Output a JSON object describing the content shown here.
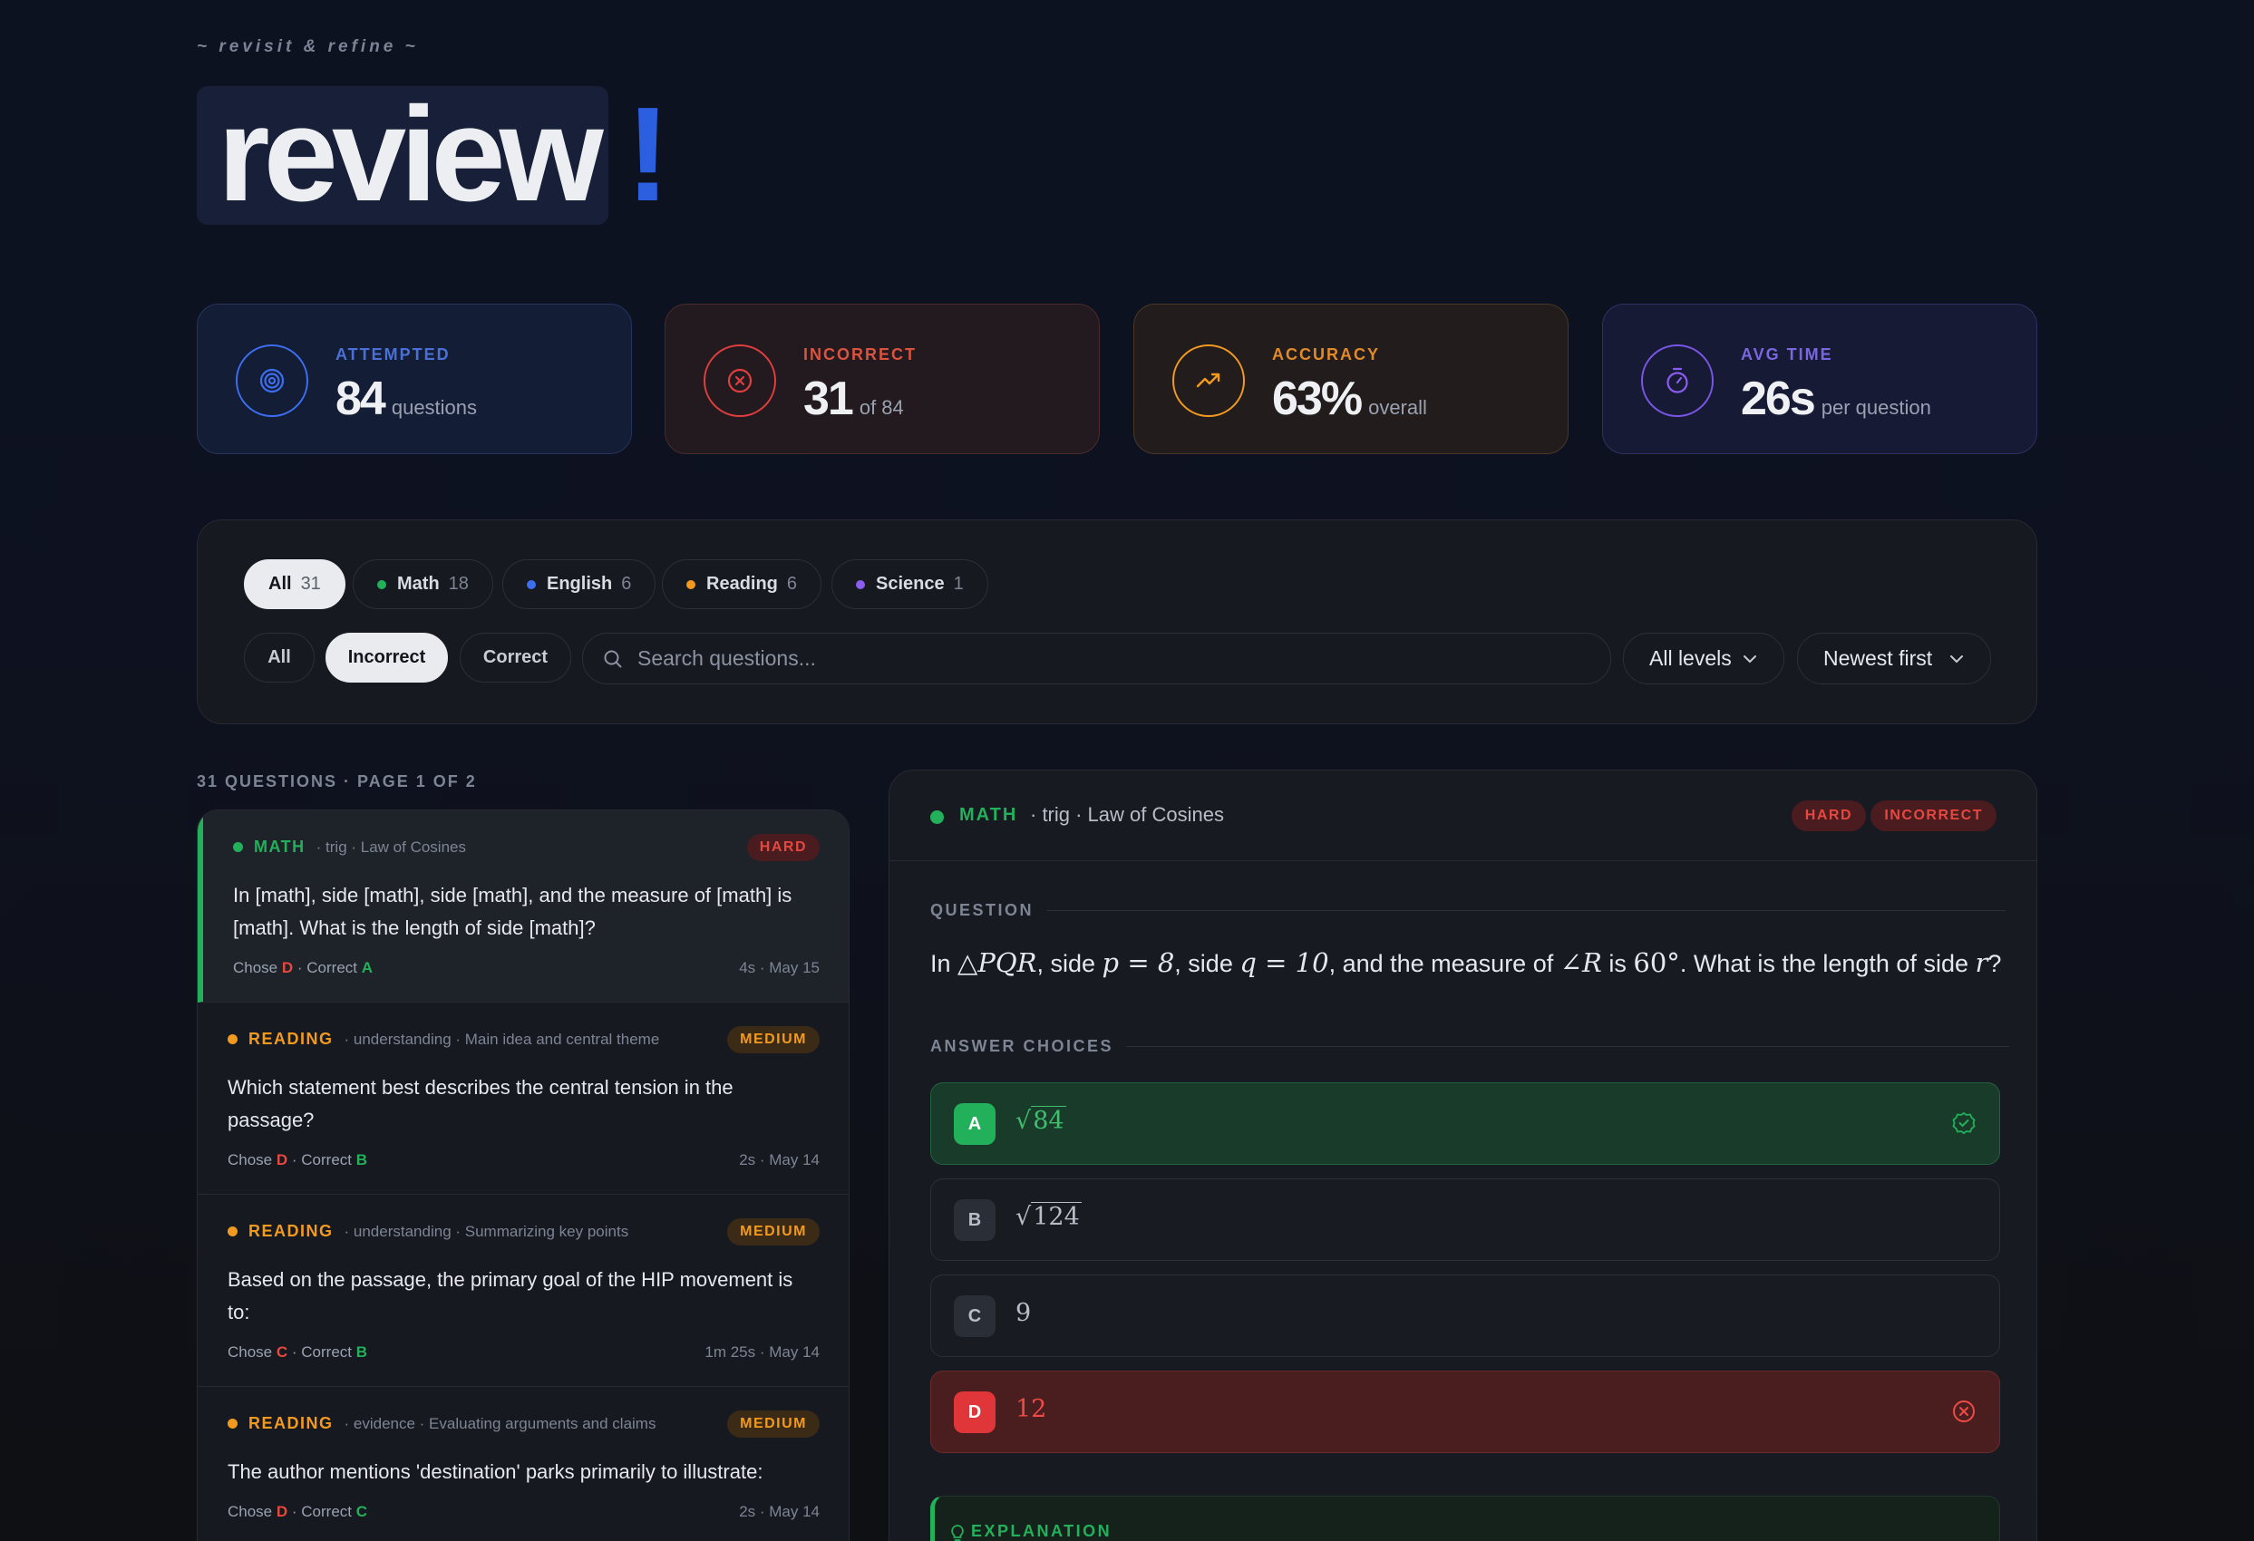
{
  "header": {
    "tagline": "~ revisit & refine ~",
    "title": "review",
    "bang": "!"
  },
  "stats": [
    {
      "label": "ATTEMPTED",
      "value": "84",
      "sub": "questions",
      "icon": "target-icon",
      "color": "#3d6ef0"
    },
    {
      "label": "INCORRECT",
      "value": "31",
      "sub": "of 84",
      "icon": "x-circle-icon",
      "color": "#e03e3e"
    },
    {
      "label": "ACCURACY",
      "value": "63%",
      "sub": "overall",
      "icon": "trending-up-icon",
      "color": "#f29a1f"
    },
    {
      "label": "AVG TIME",
      "value": "26s",
      "sub": "per question",
      "icon": "stopwatch-icon",
      "color": "#7a56e6"
    }
  ],
  "subjects": [
    {
      "label": "All",
      "count": "31",
      "active": true
    },
    {
      "label": "Math",
      "count": "18",
      "color": "#22b15a"
    },
    {
      "label": "English",
      "count": "6",
      "color": "#3d6ef0"
    },
    {
      "label": "Reading",
      "count": "6",
      "color": "#f29a1f"
    },
    {
      "label": "Science",
      "count": "1",
      "color": "#8a5cf0"
    }
  ],
  "result_filters": [
    {
      "label": "All"
    },
    {
      "label": "Incorrect",
      "active": true
    },
    {
      "label": "Correct"
    }
  ],
  "search": {
    "placeholder": "Search questions..."
  },
  "level_select": {
    "value": "All levels"
  },
  "sort_select": {
    "value": "Newest first"
  },
  "list_heading": "31 QUESTIONS · PAGE 1 OF 2",
  "questions": [
    {
      "subject": "MATH",
      "color": "#22b15a",
      "topic": "· trig · Law of Cosines",
      "difficulty": "HARD",
      "text": "In [math], side [math], side [math], and the measure of [math] is [math]. What is the length of side [math]?",
      "chose_label": "Chose",
      "chose": "D",
      "correct_label": "· Correct",
      "correct": "A",
      "time": "4s · May 15"
    },
    {
      "subject": "READING",
      "color": "#f29a1f",
      "topic": "· understanding · Main idea and central theme",
      "difficulty": "MEDIUM",
      "text": "Which statement best describes the central tension in the passage?",
      "chose_label": "Chose",
      "chose": "D",
      "correct_label": "· Correct",
      "correct": "B",
      "time": "2s · May 14"
    },
    {
      "subject": "READING",
      "color": "#f29a1f",
      "topic": "· understanding · Summarizing key points",
      "difficulty": "MEDIUM",
      "text": "Based on the passage, the primary goal of the HIP movement is to:",
      "chose_label": "Chose",
      "chose": "C",
      "correct_label": "· Correct",
      "correct": "B",
      "time": "1m 25s · May 14"
    },
    {
      "subject": "READING",
      "color": "#f29a1f",
      "topic": "· evidence · Evaluating arguments and claims",
      "difficulty": "MEDIUM",
      "text": "The author mentions 'destination' parks primarily to illustrate:",
      "chose_label": "Chose",
      "chose": "D",
      "correct_label": "· Correct",
      "correct": "C",
      "time": "2s · May 14"
    }
  ],
  "detail": {
    "subject": "MATH",
    "topic": "· trig · Law of Cosines",
    "badges": [
      "HARD",
      "INCORRECT"
    ],
    "question_heading": "QUESTION",
    "q": {
      "p1": "In",
      "tri": "△PQR",
      "p2": ", side",
      "pv": "p = 8",
      "p3": ", side",
      "qv": "q = 10",
      "p4": ", and the measure of",
      "ang": "∠R",
      "p5": "is",
      "deg": "60°",
      "p6": ". What is the length of side",
      "rv": "r",
      "p7": "?"
    },
    "answers_heading": "ANSWER CHOICES",
    "choices": [
      {
        "letter": "A",
        "value": "84",
        "sqrt": true,
        "state": "correct"
      },
      {
        "letter": "B",
        "value": "124",
        "sqrt": true,
        "state": "none"
      },
      {
        "letter": "C",
        "value": "9",
        "sqrt": false,
        "state": "none"
      },
      {
        "letter": "D",
        "value": "12",
        "sqrt": false,
        "state": "wrong"
      }
    ],
    "explanation_heading": "EXPLANATION"
  }
}
